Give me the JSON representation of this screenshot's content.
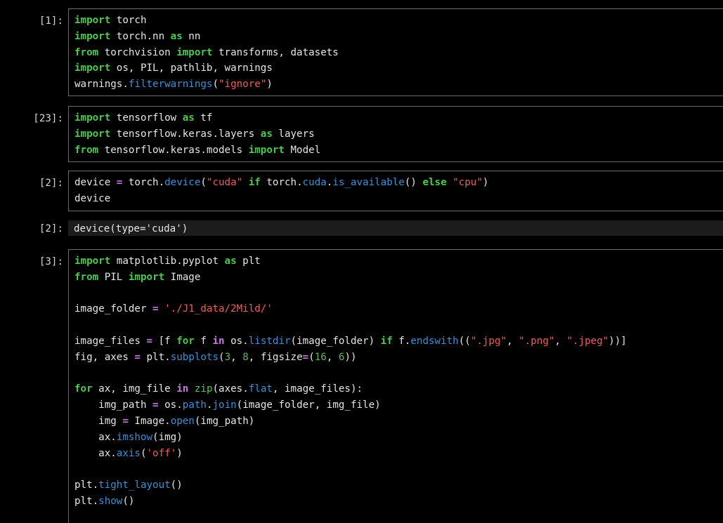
{
  "cells": [
    {
      "prompt": "[1]:",
      "lines": [
        [
          {
            "t": "import",
            "c": "kw"
          },
          {
            "t": " torch",
            "c": ""
          }
        ],
        [
          {
            "t": "import",
            "c": "kw"
          },
          {
            "t": " torch.nn ",
            "c": ""
          },
          {
            "t": "as",
            "c": "kw"
          },
          {
            "t": " nn",
            "c": ""
          }
        ],
        [
          {
            "t": "from",
            "c": "kw"
          },
          {
            "t": " torchvision ",
            "c": ""
          },
          {
            "t": "import",
            "c": "kw"
          },
          {
            "t": " transforms, datasets",
            "c": ""
          }
        ],
        [
          {
            "t": "import",
            "c": "kw"
          },
          {
            "t": " os, PIL, pathlib, warnings",
            "c": ""
          }
        ],
        [
          {
            "t": "warnings.",
            "c": ""
          },
          {
            "t": "filterwarnings",
            "c": "fn"
          },
          {
            "t": "(",
            "c": ""
          },
          {
            "t": "\"ignore\"",
            "c": "str"
          },
          {
            "t": ")",
            "c": ""
          }
        ]
      ]
    },
    {
      "prompt": "[23]:",
      "lines": [
        [
          {
            "t": "import",
            "c": "kw"
          },
          {
            "t": " tensorflow ",
            "c": ""
          },
          {
            "t": "as",
            "c": "kw"
          },
          {
            "t": " tf",
            "c": ""
          }
        ],
        [
          {
            "t": "import",
            "c": "kw"
          },
          {
            "t": " tensorflow.keras.layers ",
            "c": ""
          },
          {
            "t": "as",
            "c": "kw"
          },
          {
            "t": " layers",
            "c": ""
          }
        ],
        [
          {
            "t": "from",
            "c": "kw"
          },
          {
            "t": " tensorflow.keras.models ",
            "c": ""
          },
          {
            "t": "import",
            "c": "kw"
          },
          {
            "t": " Model",
            "c": ""
          }
        ]
      ]
    },
    {
      "prompt": "[2]:",
      "lines": [
        [
          {
            "t": "device ",
            "c": ""
          },
          {
            "t": "=",
            "c": "op"
          },
          {
            "t": " torch.",
            "c": ""
          },
          {
            "t": "device",
            "c": "fn"
          },
          {
            "t": "(",
            "c": ""
          },
          {
            "t": "\"cuda\"",
            "c": "str"
          },
          {
            "t": " ",
            "c": ""
          },
          {
            "t": "if",
            "c": "kw"
          },
          {
            "t": " torch.",
            "c": ""
          },
          {
            "t": "cuda",
            "c": "fn"
          },
          {
            "t": ".",
            "c": ""
          },
          {
            "t": "is_available",
            "c": "fn"
          },
          {
            "t": "() ",
            "c": ""
          },
          {
            "t": "else",
            "c": "kw"
          },
          {
            "t": " ",
            "c": ""
          },
          {
            "t": "\"cpu\"",
            "c": "str"
          },
          {
            "t": ")",
            "c": ""
          }
        ],
        [
          {
            "t": "device",
            "c": ""
          }
        ]
      ]
    },
    {
      "prompt": "[3]:",
      "lines": [
        [
          {
            "t": "import",
            "c": "kw"
          },
          {
            "t": " matplotlib.pyplot ",
            "c": ""
          },
          {
            "t": "as",
            "c": "kw"
          },
          {
            "t": " plt",
            "c": ""
          }
        ],
        [
          {
            "t": "from",
            "c": "kw"
          },
          {
            "t": " PIL ",
            "c": ""
          },
          {
            "t": "import",
            "c": "kw"
          },
          {
            "t": " Image",
            "c": ""
          }
        ],
        [],
        [
          {
            "t": "image_folder ",
            "c": ""
          },
          {
            "t": "=",
            "c": "op"
          },
          {
            "t": " ",
            "c": ""
          },
          {
            "t": "'./J1_data/2Mild/'",
            "c": "str"
          }
        ],
        [],
        [
          {
            "t": "image_files ",
            "c": ""
          },
          {
            "t": "=",
            "c": "op"
          },
          {
            "t": " [f ",
            "c": ""
          },
          {
            "t": "for",
            "c": "kw"
          },
          {
            "t": " f ",
            "c": ""
          },
          {
            "t": "in",
            "c": "op"
          },
          {
            "t": " os.",
            "c": ""
          },
          {
            "t": "listdir",
            "c": "fn"
          },
          {
            "t": "(image_folder) ",
            "c": ""
          },
          {
            "t": "if",
            "c": "kw"
          },
          {
            "t": " f.",
            "c": ""
          },
          {
            "t": "endswith",
            "c": "fn"
          },
          {
            "t": "((",
            "c": ""
          },
          {
            "t": "\".jpg\"",
            "c": "str"
          },
          {
            "t": ", ",
            "c": ""
          },
          {
            "t": "\".png\"",
            "c": "str"
          },
          {
            "t": ", ",
            "c": ""
          },
          {
            "t": "\".jpeg\"",
            "c": "str"
          },
          {
            "t": "))]",
            "c": ""
          }
        ],
        [
          {
            "t": "fig, axes ",
            "c": ""
          },
          {
            "t": "=",
            "c": "op"
          },
          {
            "t": " plt.",
            "c": ""
          },
          {
            "t": "subplots",
            "c": "fn"
          },
          {
            "t": "(",
            "c": ""
          },
          {
            "t": "3",
            "c": "num"
          },
          {
            "t": ", ",
            "c": ""
          },
          {
            "t": "8",
            "c": "num"
          },
          {
            "t": ", figsize",
            "c": ""
          },
          {
            "t": "=",
            "c": "op"
          },
          {
            "t": "(",
            "c": ""
          },
          {
            "t": "16",
            "c": "num"
          },
          {
            "t": ", ",
            "c": ""
          },
          {
            "t": "6",
            "c": "num"
          },
          {
            "t": "))",
            "c": ""
          }
        ],
        [],
        [
          {
            "t": "for",
            "c": "kw"
          },
          {
            "t": " ax, img_file ",
            "c": ""
          },
          {
            "t": "in",
            "c": "op"
          },
          {
            "t": " ",
            "c": ""
          },
          {
            "t": "zip",
            "c": "bi"
          },
          {
            "t": "(axes.",
            "c": ""
          },
          {
            "t": "flat",
            "c": "fn"
          },
          {
            "t": ", image_files):",
            "c": ""
          }
        ],
        [
          {
            "t": "    img_path ",
            "c": ""
          },
          {
            "t": "=",
            "c": "op"
          },
          {
            "t": " os.",
            "c": ""
          },
          {
            "t": "path",
            "c": "fn"
          },
          {
            "t": ".",
            "c": ""
          },
          {
            "t": "join",
            "c": "fn"
          },
          {
            "t": "(image_folder, img_file)",
            "c": ""
          }
        ],
        [
          {
            "t": "    img ",
            "c": ""
          },
          {
            "t": "=",
            "c": "op"
          },
          {
            "t": " Image.",
            "c": ""
          },
          {
            "t": "open",
            "c": "fn"
          },
          {
            "t": "(img_path)",
            "c": ""
          }
        ],
        [
          {
            "t": "    ax.",
            "c": ""
          },
          {
            "t": "imshow",
            "c": "fn"
          },
          {
            "t": "(img)",
            "c": ""
          }
        ],
        [
          {
            "t": "    ax.",
            "c": ""
          },
          {
            "t": "axis",
            "c": "fn"
          },
          {
            "t": "(",
            "c": ""
          },
          {
            "t": "'off'",
            "c": "str"
          },
          {
            "t": ")",
            "c": ""
          }
        ],
        [],
        [
          {
            "t": "plt.",
            "c": ""
          },
          {
            "t": "tight_layout",
            "c": "fn"
          },
          {
            "t": "()",
            "c": ""
          }
        ],
        [
          {
            "t": "plt.",
            "c": ""
          },
          {
            "t": "show",
            "c": "fn"
          },
          {
            "t": "()",
            "c": ""
          }
        ]
      ]
    }
  ],
  "outputs": [
    {
      "prompt": "[2]:",
      "text": "device(type='cuda')"
    }
  ]
}
